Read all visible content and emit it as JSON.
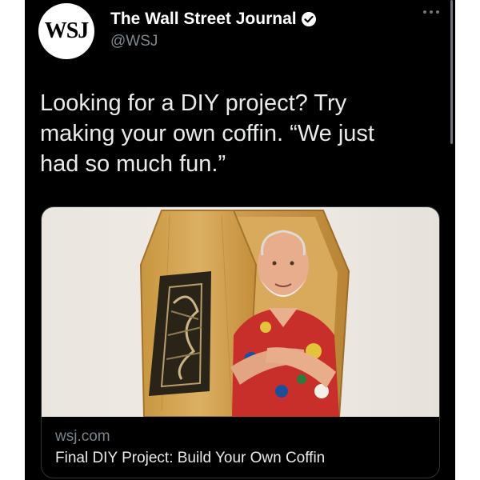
{
  "account": {
    "avatar_text": "WSJ",
    "name": "The Wall Street Journal",
    "handle": "@WSJ",
    "verified_icon": "verified-badge-icon",
    "more_icon": "more-dots-icon"
  },
  "tweet": {
    "text": "Looking for a DIY project? Try making your own coffin. “We just had so much fun.”"
  },
  "link_card": {
    "image_icon": "coffin-photo",
    "domain": "wsj.com",
    "title": "Final DIY Project: Build Your Own Coffin"
  },
  "colors": {
    "background": "#000000",
    "text": "#e9eaeb",
    "muted": "#7b838b",
    "border": "#2f3336"
  }
}
